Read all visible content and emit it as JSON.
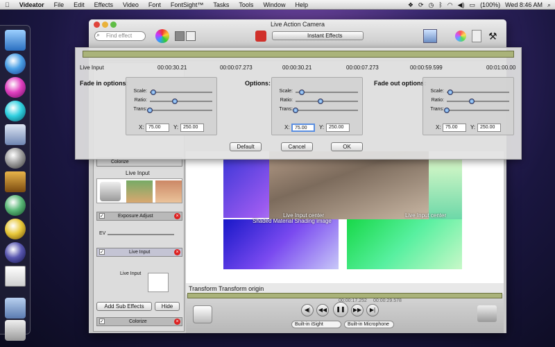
{
  "menubar": {
    "app": "Videator",
    "items": [
      "File",
      "Edit",
      "Effects",
      "Video",
      "Font",
      "FontSight™",
      "Tasks",
      "Tools",
      "Window",
      "Help"
    ],
    "battery": "(100%)",
    "clock": "Wed 8:46 AM"
  },
  "window": {
    "title": "Live Action Camera",
    "find_placeholder": "Find effect",
    "effects_popup": "Instant Effects"
  },
  "sheet": {
    "live_input_label": "Live Input",
    "timecodes": [
      "00:00:30.21",
      "00:00:07.273",
      "00:00:30.21",
      "00:00:07.273",
      "00:00:59.599",
      "00:01:00.00"
    ],
    "sections": [
      {
        "title": "Fade in options:",
        "x": "75.00",
        "y": "250.00",
        "scale": 0.05,
        "ratio": 0.4,
        "trans": 0.0
      },
      {
        "title": "Options:",
        "x": "75.00",
        "y": "250.00",
        "scale": 0.1,
        "ratio": 0.4,
        "trans": 0.0
      },
      {
        "title": "Fade out options:",
        "x": "75.00",
        "y": "250.00",
        "scale": 0.05,
        "ratio": 0.4,
        "trans": 0.0
      }
    ],
    "slider_labels": {
      "scale": "Scale:",
      "ratio": "Ratio:",
      "trans": "Trans:"
    },
    "x_label": "X:",
    "y_label": "Y:",
    "buttons": {
      "default": "Default",
      "cancel": "Cancel",
      "ok": "OK"
    }
  },
  "left_panel": {
    "colorize_top": "Colorize",
    "live_input_header": "Live Input",
    "exposure": "Exposure Adjust",
    "ev_label": "EV",
    "live_input_row": "Live Input",
    "live_input_sub": "Live Input",
    "add_sub_effects": "Add Sub Effects",
    "hide": "Hide",
    "colorize_bottom": "Colorize"
  },
  "canvas": {
    "live_input_center_1": "Live Input center",
    "shaded_material": "Shaded Material Shading image",
    "live_input_center_2": "Live Input center"
  },
  "timeline": {
    "transform_label": "Transform Transform origin",
    "timecode_a": "00:00:17.252",
    "timecode_b": "00:00:29.578"
  },
  "transport": {
    "video_source": "Built-in iSight",
    "audio_source": "Built-in Microphone"
  }
}
